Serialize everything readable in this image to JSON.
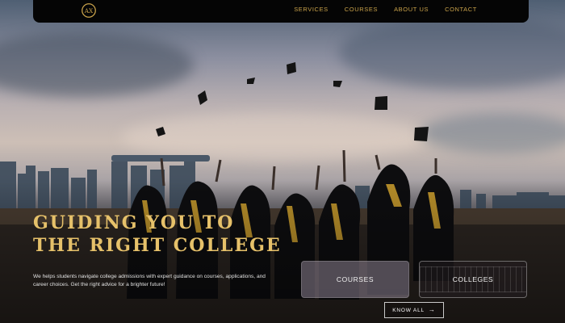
{
  "nav": {
    "logo_letters": "AX",
    "links": [
      "SERVICES",
      "COURSES",
      "ABOUT US",
      "CONTACT"
    ]
  },
  "hero": {
    "headline_line1": "GUIDING YOU TO",
    "headline_line2": "THE RIGHT COLLEGE",
    "description": "We helps students navigate college admissions with expert guidance on courses, applications, and career choices. Get the right advice for a brighter future!"
  },
  "cards": {
    "courses_label": "COURSES",
    "colleges_label": "COLLEGES"
  },
  "cta": {
    "label": "KNOW ALL",
    "icon": "arrow-right-icon"
  },
  "colors": {
    "accent_gold": "#c9a24a",
    "headline_gold": "#e6c16a",
    "navbar_bg": "#050505"
  }
}
